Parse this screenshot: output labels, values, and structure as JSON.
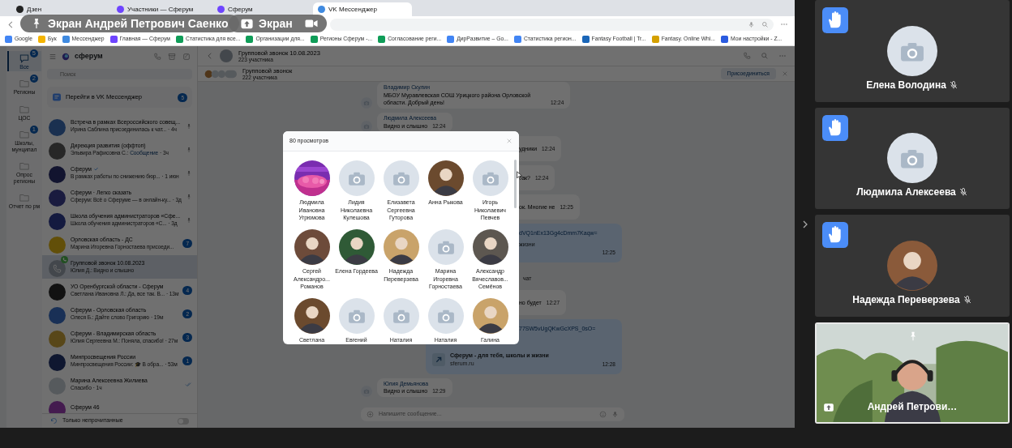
{
  "presenter": {
    "label": "Экран Андрей Петрович Саенко",
    "share_label": "Экран"
  },
  "browser": {
    "tabs": [
      {
        "title": "Дзен",
        "selected": false
      },
      {
        "title": "Участники — Сферум",
        "selected": false
      },
      {
        "title": "Сферум",
        "selected": false
      },
      {
        "title": "VK Мессенджер",
        "selected": true
      }
    ],
    "bookmarks": [
      "Google",
      "Бук",
      "Мессенджер",
      "Главная — Сферум",
      "Статистика для все...",
      "Организации для...",
      "Регионы Сферум -...",
      "Согласование реги...",
      "ДирРазвитие – Go...",
      "Статистика регион...",
      "Fantasy Football | Tr...",
      "Fantasy. Online Whi...",
      "Мои настройки - Z..."
    ]
  },
  "messenger": {
    "rail": [
      {
        "label": "Все",
        "badge": "5",
        "selected": true
      },
      {
        "label": "Регионы",
        "badge": "2",
        "selected": false
      },
      {
        "label": "ЦОС",
        "selected": false
      },
      {
        "label": "Школы, мунципал",
        "badge": "1",
        "selected": false
      },
      {
        "label": "Опрос регионы",
        "selected": false
      },
      {
        "label": "Отчет по рм",
        "selected": false
      }
    ],
    "brand": "сферум",
    "search_placeholder": "Поиск",
    "promo": {
      "label": "Перейти в VK Мессенджер",
      "badge": "5"
    },
    "chats": [
      {
        "title": "Встреча в рамках Всероссийского совещ...",
        "preview": "Ирина Саблина присоединилась к чат...",
        "time": "· 4ч",
        "pinned": true,
        "selected": false
      },
      {
        "title": "Дирекция развития (оффтоп)",
        "preview": "Эльвира Рафисовна С.:",
        "preview_link": "Сообщение",
        "time": "· 3ч",
        "pinned": true,
        "selected": false
      },
      {
        "title": "Сферум",
        "verified": true,
        "preview": "В рамках работы по снижению бюр...",
        "time": "· 1 июн",
        "pinned": true,
        "selected": false
      },
      {
        "title": "Сферум · Легко сказать",
        "preview": "Сферум: Всё о Сферуме — в онлайн-ку...",
        "time": "· 3д",
        "pinned": true,
        "selected": false
      },
      {
        "title": "Школа обучения администраторов «Сфе...",
        "preview": "Школа обучения администраторов «С...",
        "time": "· 3д",
        "pinned": true,
        "selected": false
      },
      {
        "title": "Орловская область - ДС",
        "preview": "Марина Игоревна Горностаева присоеди...",
        "badge": "7",
        "selected": false
      },
      {
        "title": "Групповой звонок 10.08.2023",
        "preview": "Юлия Д.: Видно и слышно",
        "call": true,
        "selected": true
      },
      {
        "title": "УО Оренбургской области - Сферум",
        "preview": "Светлана Ивановна Л.: Да, все так. В...",
        "time": "· 13м",
        "badge": "4",
        "selected": false
      },
      {
        "title": "Сферум - Орловская область",
        "preview": "Олеся Б.: Дайте слово Григорию",
        "time": "· 19м",
        "badge": "2",
        "selected": false
      },
      {
        "title": "Сферум - Владимирская область",
        "preview": "Юлия Сергеевна М.: Поняла, спасибо!",
        "time": "· 27м",
        "badge": "3",
        "selected": false
      },
      {
        "title": "Минпросвещения России",
        "preview": "Минпросвещения России: 🎓 В обра...",
        "time": "· 53м",
        "badge": "1",
        "selected": false
      },
      {
        "title": "Марина Алексеевна Жилиева",
        "preview": "Спасибо",
        "time": "· 1ч",
        "read": true,
        "selected": false
      },
      {
        "title": "Сферум 46",
        "selected": false
      }
    ],
    "unread_only": {
      "label": "Только непрочитанные",
      "on": false
    }
  },
  "chat": {
    "title": "Групповой звонок 10.08.2023",
    "subtitle": "223 участника",
    "call": {
      "title": "Групповой звонок",
      "subtitle": "222 участника",
      "join": "Присоединиться"
    },
    "messages": [
      {
        "kind": "text",
        "sender": "Владимир Скулин",
        "text": "МБОУ Муравлевская СОШ Урицкого района Орловской области. Добрый день!",
        "time": "12:24"
      },
      {
        "kind": "text",
        "sender": "Людмила Алексеева",
        "text": "Видно и слышно",
        "time": "12:24"
      },
      {
        "kind": "fragment",
        "text": "удники",
        "time": "12:24"
      },
      {
        "kind": "fragment",
        "text": "так?",
        "time": "12:24"
      },
      {
        "kind": "fragment",
        "text": "ок. Многие не",
        "time": "12:25"
      },
      {
        "kind": "link",
        "link": "dVQ1nEx13Gg4cDmm7Kaqw=",
        "text": "жизни",
        "time": "12:25"
      },
      {
        "kind": "system",
        "text": "чат"
      },
      {
        "kind": "fragment",
        "text": "но будет",
        "time": "12:27"
      },
      {
        "kind": "card",
        "link": "77SW5vUgQKwGcXPS_0sO=",
        "title": "Сферум - для тебя, школы и жизни",
        "site": "sferum.ru",
        "time": "12:28"
      },
      {
        "kind": "text",
        "sender": "Юлия Демьянова",
        "text": "Видно и слышно",
        "time": "12:29"
      }
    ],
    "input_placeholder": "Напишите сообщение..."
  },
  "viewers_dialog": {
    "title": "80 просмотров",
    "viewers": [
      {
        "name": "Людмила Ивановна Угрюмова",
        "kind": "picture"
      },
      {
        "name": "Лидия Николаевна Кулешова",
        "kind": "camera"
      },
      {
        "name": "Елизавета Сергеевна Гуторова",
        "kind": "camera"
      },
      {
        "name": "Анна Рыкова"
      },
      {
        "name": "Игорь Николаевич Певчев",
        "kind": "camera"
      },
      {
        "name": "Сергей Александро... Романов"
      },
      {
        "name": "Елена Гордеева"
      },
      {
        "name": "Надежда Переверзева"
      },
      {
        "name": "Марина Игоревна Горностаева",
        "kind": "camera"
      },
      {
        "name": "Александр Вячеславов... Семёнов"
      },
      {
        "name": "Светлана"
      },
      {
        "name": "Евгений",
        "kind": "camera"
      },
      {
        "name": "Наталия",
        "kind": "camera"
      },
      {
        "name": "Наталия",
        "kind": "camera"
      },
      {
        "name": "Галина"
      }
    ]
  },
  "participants": [
    {
      "name": "Елена Володина",
      "hand_raised": true,
      "muted": true,
      "kind": "camera",
      "pinned": false,
      "sharing": false,
      "selected": false
    },
    {
      "name": "Людмила Алексеева",
      "hand_raised": true,
      "muted": true,
      "kind": "camera",
      "pinned": false,
      "sharing": false,
      "selected": false
    },
    {
      "name": "Надежда Переверзева",
      "hand_raised": true,
      "muted": true,
      "pinned": false,
      "sharing": false,
      "selected": false
    },
    {
      "name": "Андрей Петрови…",
      "hand_raised": false,
      "muted": false,
      "kind": "video",
      "pinned": true,
      "sharing": true,
      "selected": true
    }
  ]
}
